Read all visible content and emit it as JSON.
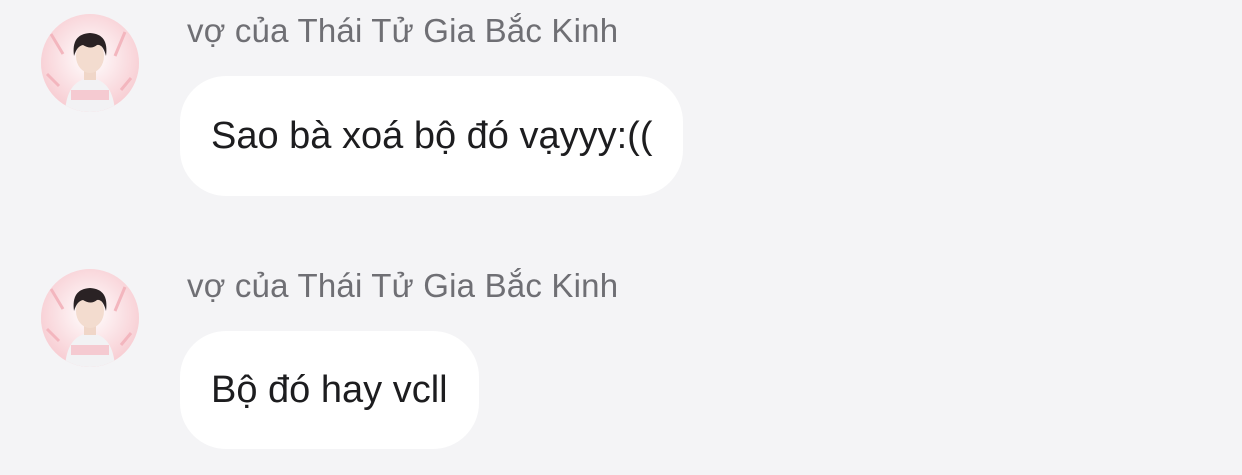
{
  "colors": {
    "background": "#f4f4f6",
    "bubble": "#ffffff",
    "sender_name": "#6f6f74",
    "message_text": "#1d1d1f"
  },
  "messages": [
    {
      "avatar_icon": "user-avatar",
      "sender": "vợ của Thái Tử Gia Bắc Kinh",
      "text": "Sao bà xoá bộ đó vạyyy:(("
    },
    {
      "avatar_icon": "user-avatar",
      "sender": "vợ của Thái Tử Gia Bắc Kinh",
      "text": "Bộ đó hay vcll"
    }
  ]
}
